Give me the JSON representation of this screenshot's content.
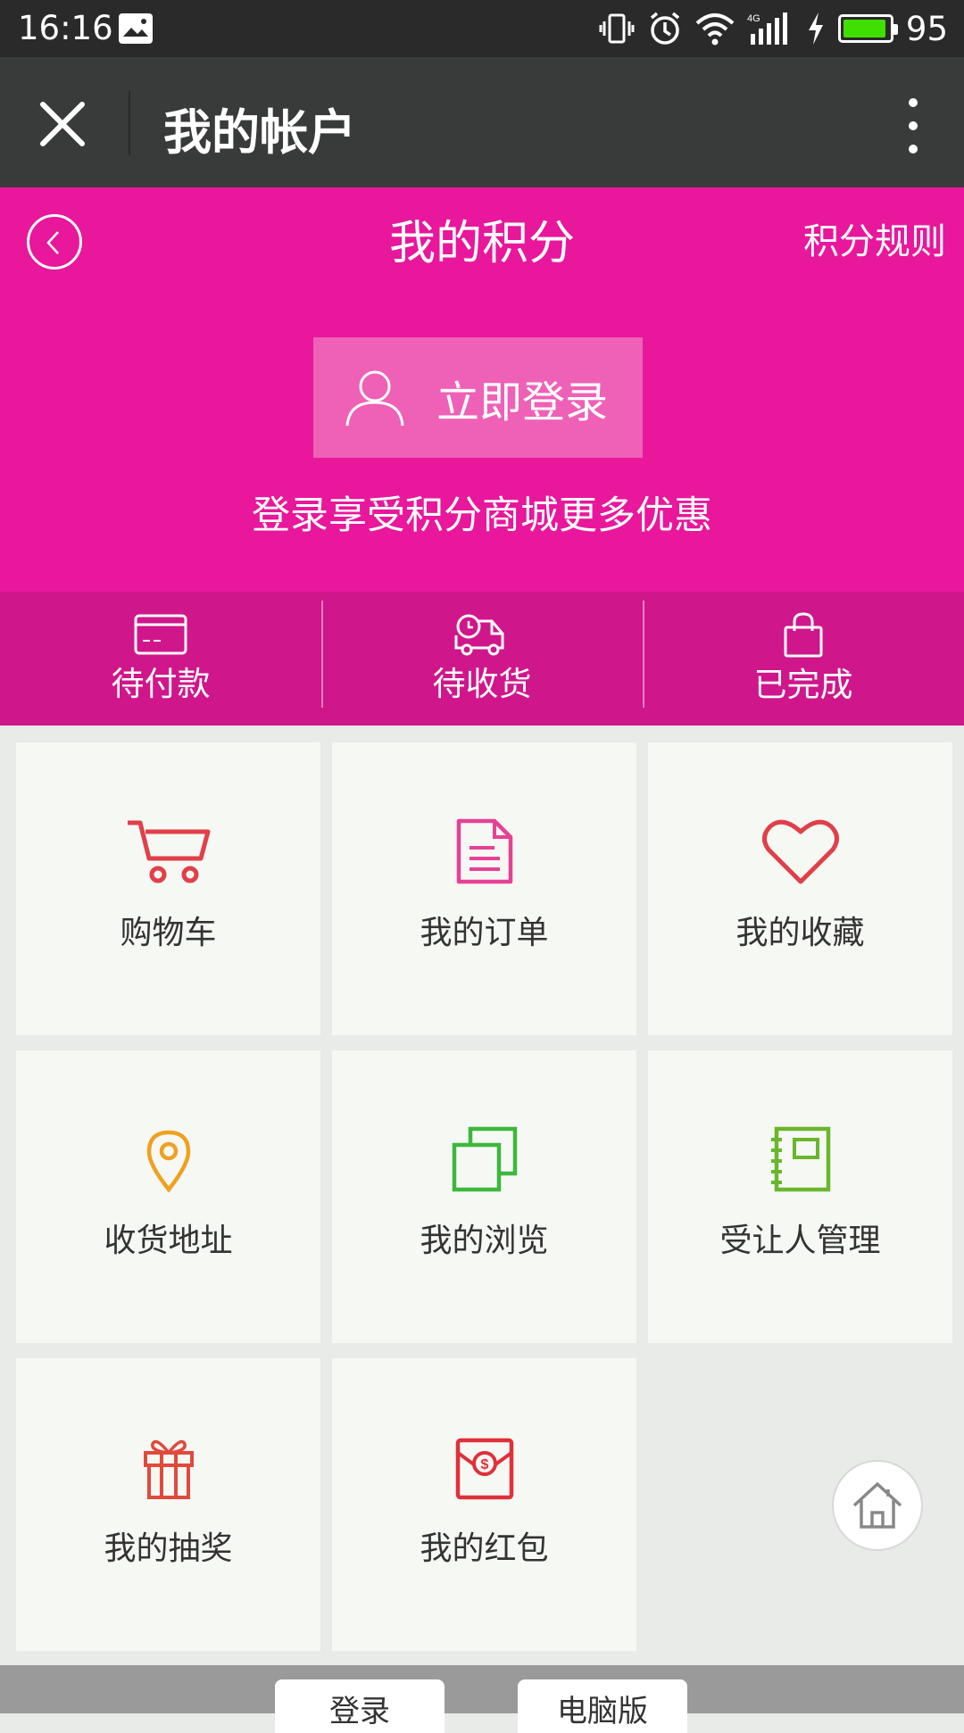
{
  "status_bar": {
    "time": "16:16",
    "battery_percent": "95",
    "battery_level": 0.95,
    "network": "4G",
    "icons": [
      "image-icon",
      "vibrate-icon",
      "alarm-icon",
      "wifi-icon",
      "signal-icon",
      "charging-icon",
      "battery-icon"
    ]
  },
  "titlebar": {
    "title": "我的帐户",
    "close_icon": "close-icon",
    "more_icon": "more-vertical-icon"
  },
  "header": {
    "title": "我的积分",
    "rules_link": "积分规则",
    "login_button": "立即登录",
    "login_hint": "登录享受积分商城更多优惠",
    "accent_color": "#e8179c"
  },
  "order_status": [
    {
      "label": "待付款",
      "icon": "card-icon"
    },
    {
      "label": "待收货",
      "icon": "delivery-truck-icon"
    },
    {
      "label": "已完成",
      "icon": "shopping-bag-icon"
    }
  ],
  "menu": [
    {
      "label": "购物车",
      "icon": "cart-icon",
      "color": "#e0404a"
    },
    {
      "label": "我的订单",
      "icon": "order-document-icon",
      "color": "#e64195"
    },
    {
      "label": "我的收藏",
      "icon": "heart-icon",
      "color": "#e0404a"
    },
    {
      "label": "收货地址",
      "icon": "location-pin-icon",
      "color": "#f0a020"
    },
    {
      "label": "我的浏览",
      "icon": "browse-history-icon",
      "color": "#3cb83c"
    },
    {
      "label": "受让人管理",
      "icon": "notebook-icon",
      "color": "#6ab62c"
    },
    {
      "label": "我的抽奖",
      "icon": "gift-icon",
      "color": "#e04a3c"
    },
    {
      "label": "我的红包",
      "icon": "red-envelope-icon",
      "color": "#e0303a"
    }
  ],
  "footer": {
    "login": "登录",
    "desktop_version": "电脑版"
  }
}
